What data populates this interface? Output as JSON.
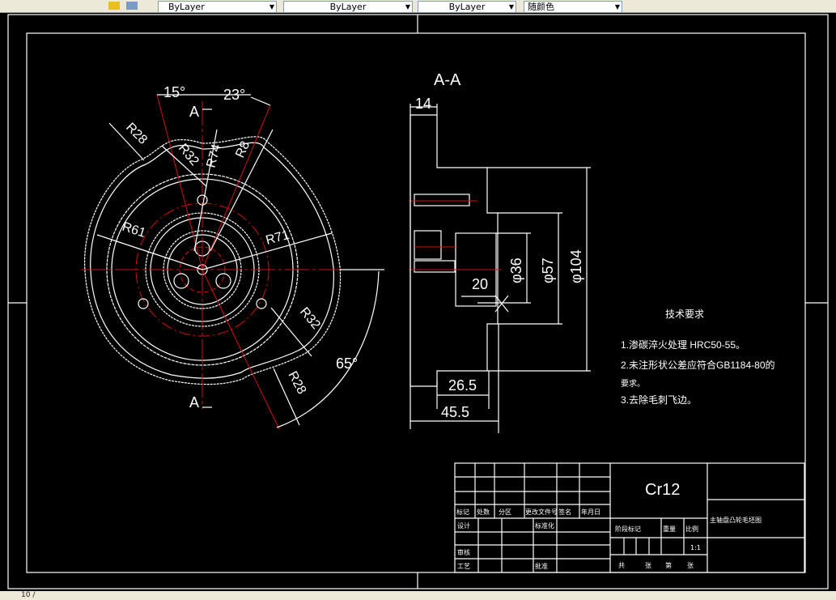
{
  "toolbar": {
    "layer_dropdowns": [
      "ByLayer",
      "ByLayer",
      "ByLayer"
    ],
    "color_dropdown": "随颜色",
    "icons": [
      "layer-manager-icon",
      "layer-states-icon"
    ]
  },
  "drawing": {
    "section_label_top": "A",
    "section_label_bottom": "A",
    "section_title": "A-A",
    "dimensions_front": {
      "angle1": "15°",
      "angle2": "23°",
      "angle3": "65°",
      "r28a": "R28",
      "r32a": "R32",
      "r74": "R74",
      "r8": "R8",
      "r61": "R61",
      "r71": "R71",
      "r32b": "R32",
      "r28b": "R28"
    },
    "dimensions_section": {
      "d14": "14",
      "d20": "20",
      "d36": "φ36",
      "d57": "φ57",
      "d104": "φ104",
      "d265": "26.5",
      "d455": "45.5"
    },
    "tech_req": {
      "title": "技术要求",
      "lines": [
        "1.渗碳淬火处理 HRC50-55。",
        "2.未注形状公差应符合GB1184-80的",
        "要求。",
        "3.去除毛刺飞边。"
      ]
    }
  },
  "title_block": {
    "material": "Cr12",
    "part_name": "主轴盘凸轮毛坯图",
    "scale": "1:1",
    "headers": [
      "标记",
      "处数",
      "分区",
      "更改文件号",
      "签名",
      "年月日"
    ],
    "design": "设计",
    "standard": "标准化",
    "review": "审核",
    "process": "工艺",
    "approve": "批准",
    "stage": "阶段标记",
    "weight": "重量",
    "ratio": "比例",
    "sheets": [
      "共",
      "张",
      "第",
      "张"
    ]
  },
  "status": {
    "text": "10 /"
  }
}
